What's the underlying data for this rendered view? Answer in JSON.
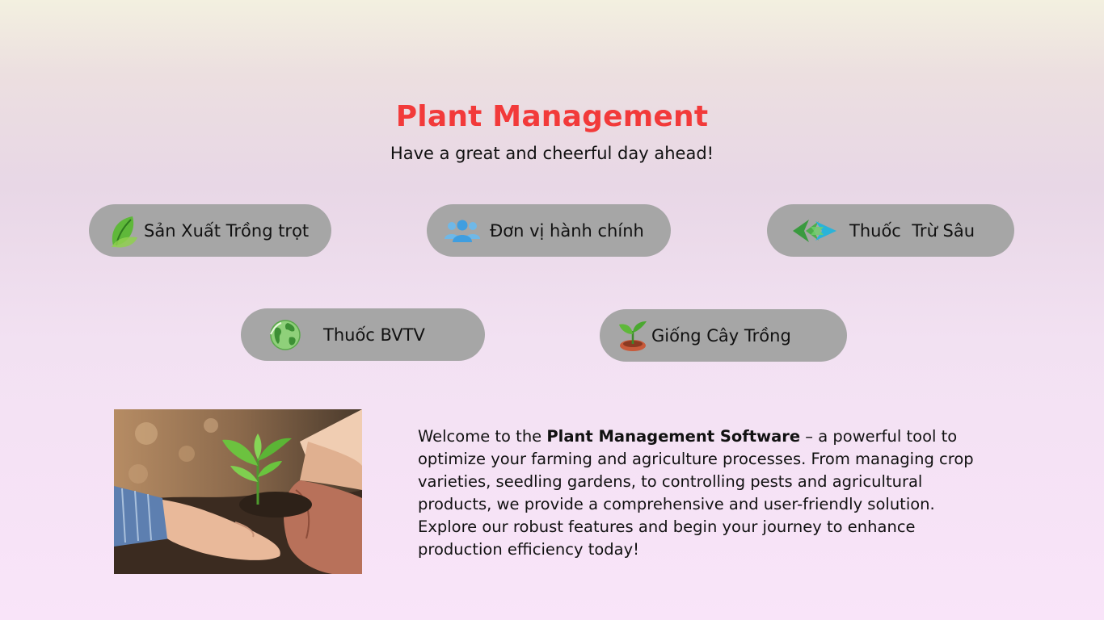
{
  "header": {
    "title": "Plant Management",
    "subtitle": "Have a great and cheerful day ahead!"
  },
  "nav": [
    {
      "label": "Sản Xuất Trồng trọt",
      "icon": "leaf-icon"
    },
    {
      "label": "Đơn vị hành chính",
      "icon": "users-icon"
    },
    {
      "label": "Thuốc  Trừ Sâu",
      "icon": "pesticide-logo-icon"
    },
    {
      "label": "Thuốc BVTV",
      "icon": "globe-icon"
    },
    {
      "label": "Giống Cây Trồng",
      "icon": "seedling-icon"
    }
  ],
  "intro": {
    "prefix": "Welcome to the ",
    "highlight": "Plant Management Software",
    "suffix": " – a powerful tool to optimize your farming and agriculture processes. From managing crop varieties, seedling gardens, to controlling pests and agricultural products, we provide a comprehensive and user-friendly solution. Explore our robust features and begin your journey to enhance production efficiency today!"
  },
  "colors": {
    "title": "#f23a3a",
    "pill_bg": "#a6a6a6"
  }
}
